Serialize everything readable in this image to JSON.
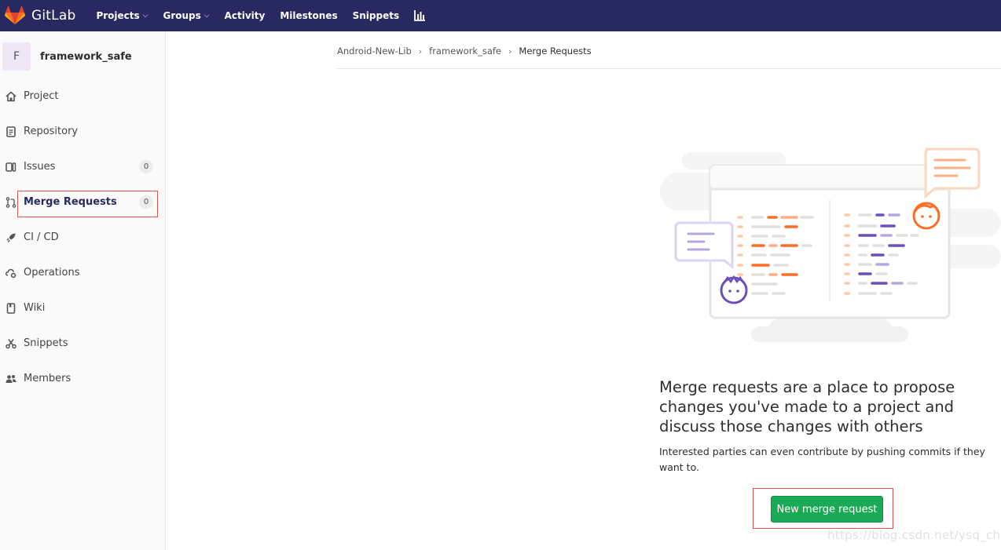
{
  "navbar": {
    "brand": "GitLab",
    "items": [
      {
        "label": "Projects",
        "dropdown": true
      },
      {
        "label": "Groups",
        "dropdown": true
      },
      {
        "label": "Activity",
        "dropdown": false
      },
      {
        "label": "Milestones",
        "dropdown": false
      },
      {
        "label": "Snippets",
        "dropdown": false
      }
    ],
    "chart_icon": "chart-icon"
  },
  "sidebar": {
    "project_initial": "F",
    "project_name": "framework_safe",
    "items": [
      {
        "label": "Project",
        "icon": "home-icon"
      },
      {
        "label": "Repository",
        "icon": "doc-icon"
      },
      {
        "label": "Issues",
        "icon": "issues-icon",
        "badge": "0"
      },
      {
        "label": "Merge Requests",
        "icon": "merge-request-icon",
        "badge": "0"
      },
      {
        "label": "CI / CD",
        "icon": "rocket-icon"
      },
      {
        "label": "Operations",
        "icon": "cloud-gear-icon"
      },
      {
        "label": "Wiki",
        "icon": "book-icon"
      },
      {
        "label": "Snippets",
        "icon": "scissors-icon"
      },
      {
        "label": "Members",
        "icon": "users-icon"
      }
    ]
  },
  "breadcrumb": {
    "items": [
      "Android-New-Lib",
      "framework_safe"
    ],
    "current": "Merge Requests"
  },
  "empty_state": {
    "title": "Merge requests are a place to propose changes you've made to a project and discuss those changes with others",
    "description": "Interested parties can even contribute by pushing commits if they want to.",
    "button_label": "New merge request"
  },
  "watermark": "https://blog.csdn.net/ysq_chris",
  "colors": {
    "navbar": "#292961",
    "button": "#1aaa55",
    "highlight": "#d9534f"
  }
}
